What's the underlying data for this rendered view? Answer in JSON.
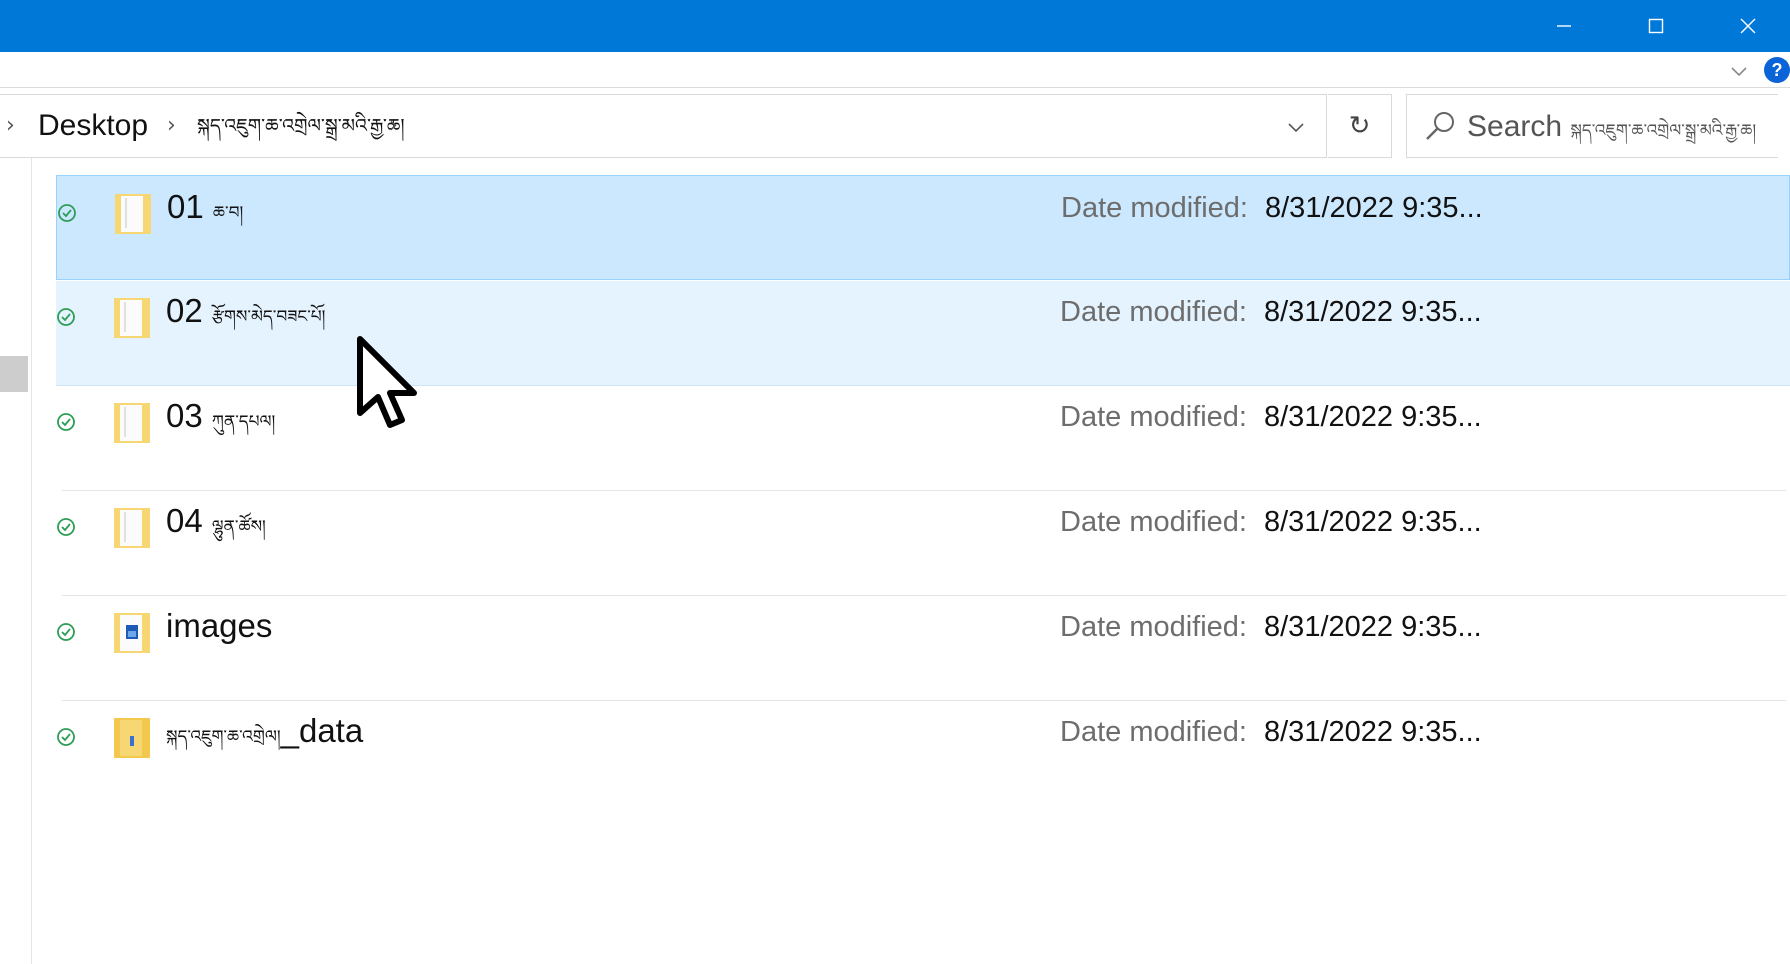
{
  "titlebar": {
    "minimize_label": "─",
    "maximize_label": "☐",
    "close_label": "✕",
    "color": "#0078d7"
  },
  "ribbon": {
    "expand_icon": "chevron-down-icon",
    "help_label": "?"
  },
  "address_bar": {
    "crumbs": [
      {
        "label": "Desktop"
      },
      {
        "label": "སྐད་འཇུག་ཆ་འགྲེལ་སྒྲ་མའི་རྒྱ་ཆ།"
      }
    ],
    "dropdown_icon": "chevron-down-icon",
    "refresh_label": "↻"
  },
  "search": {
    "label": "Search",
    "scope": "སྐད་འཇུག་ཆ་འགྲེལ་སྒྲ་མའི་རྒྱ་ཆ།"
  },
  "files": [
    {
      "name": "01",
      "name_suffix": "ཆ་བ།",
      "date_label": "Date modified:",
      "date": "8/31/2022 9:35...",
      "icon": "folder-icon",
      "status": "synced"
    },
    {
      "name": "02",
      "name_suffix": "རྩོགས་མེད་བཟང་པོ།",
      "date_label": "Date modified:",
      "date": "8/31/2022 9:35...",
      "icon": "folder-icon",
      "status": "synced"
    },
    {
      "name": "03",
      "name_suffix": "ཀུན་དཔལ།",
      "date_label": "Date modified:",
      "date": "8/31/2022 9:35...",
      "icon": "folder-icon",
      "status": "synced"
    },
    {
      "name": "04",
      "name_suffix": "ལྷུན་ཚོས།",
      "date_label": "Date modified:",
      "date": "8/31/2022 9:35...",
      "icon": "folder-icon",
      "status": "synced"
    },
    {
      "name": "images",
      "name_suffix": "",
      "date_label": "Date modified:",
      "date": "8/31/2022 9:35...",
      "icon": "image-folder-icon",
      "status": "synced"
    },
    {
      "name_prefix": "སྐད་འཇུག་ཆ་འགྲེལ།",
      "name": "_data",
      "date_label": "Date modified:",
      "date": "8/31/2022 9:35...",
      "icon": "folder-icon",
      "status": "synced"
    }
  ],
  "colors": {
    "accent": "#0078d7",
    "selected_row": "#cce8ff",
    "hover_row": "#e5f3ff",
    "status_ok": "#2e9e57",
    "folder": "#f7d774"
  }
}
